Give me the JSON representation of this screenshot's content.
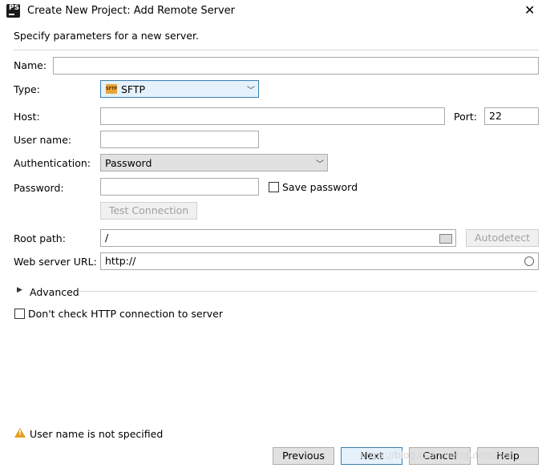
{
  "window": {
    "title": "Create New Project: Add Remote Server",
    "app_icon_text": "PS",
    "close_glyph": "✕"
  },
  "subtitle": "Specify parameters for a new server.",
  "form": {
    "name": {
      "label": "Name:",
      "value": ""
    },
    "type": {
      "label": "Type:",
      "value": "SFTP",
      "icon": "sftp-icon"
    },
    "host": {
      "label": "Host:",
      "value": ""
    },
    "port": {
      "label": "Port:",
      "value": "22"
    },
    "username": {
      "label": "User name:",
      "value": ""
    },
    "authentication": {
      "label": "Authentication:",
      "value": "Password"
    },
    "password": {
      "label": "Password:",
      "value": ""
    },
    "save_password": {
      "label": "Save password",
      "checked": false
    },
    "test_connection": {
      "label": "Test Connection",
      "enabled": false
    },
    "root_path": {
      "label": "Root path:",
      "value": "/"
    },
    "autodetect": {
      "label": "Autodetect",
      "enabled": false
    },
    "web_server_url": {
      "label": "Web server URL:",
      "value": "http://"
    }
  },
  "advanced": {
    "label": "Advanced"
  },
  "dont_check_http": {
    "label": "Don't check HTTP connection to server",
    "checked": false
  },
  "warning": {
    "text": "User name is not specified"
  },
  "footer": {
    "previous": "Previous",
    "next": "Next",
    "cancel": "Cancel",
    "help": "Help"
  },
  "watermark": "https://blog.csdn.net/gufenchen"
}
